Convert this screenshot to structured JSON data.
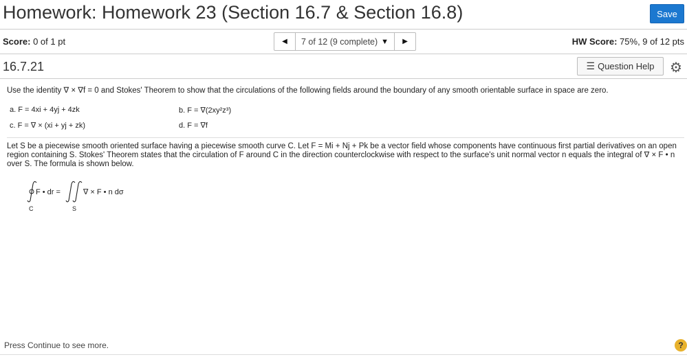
{
  "header": {
    "title": "Homework: Homework 23 (Section 16.7 & Section 16.8)",
    "save_label": "Save",
    "accent": "#1b78d0"
  },
  "scorebar": {
    "score_label": "Score:",
    "score_value": "0 of 1 pt",
    "nav_text": "7 of 12 (9 complete)",
    "hw_label": "HW Score:",
    "hw_value": "75%, 9 of 12 pts"
  },
  "question": {
    "number": "16.7.21",
    "help_label": "Question Help"
  },
  "content": {
    "intro": "Use the identity ∇ × ∇f = 0 and Stokes' Theorem to show that the circulations of the following fields around the boundary of any smooth orientable surface in space are zero.",
    "choice_a": "a. F = 4xi + 4yj + 4zk",
    "choice_b": "b. F = ∇(2xy²z³)",
    "choice_c": "c. F = ∇ × (xi + yj + zk)",
    "choice_d": "d. F = ∇f",
    "paragraph": "Let S be a piecewise smooth oriented surface having a piecewise smooth curve C. Let F = Mi + Nj + Pk be a vector field whose components have continuous first partial derivatives on an open region containing S. Stokes' Theorem states that the circulation of F around C in the direction counterclockwise with respect to the surface's unit normal vector n equals the integral of ∇ × F • n over S. The formula is shown below.",
    "formula_left": "F • dr =",
    "formula_right": "∇ × F • n dσ",
    "sub_c": "C",
    "sub_s": "S"
  },
  "footer": {
    "text": "Press Continue to see more.",
    "help_glyph": "?"
  }
}
